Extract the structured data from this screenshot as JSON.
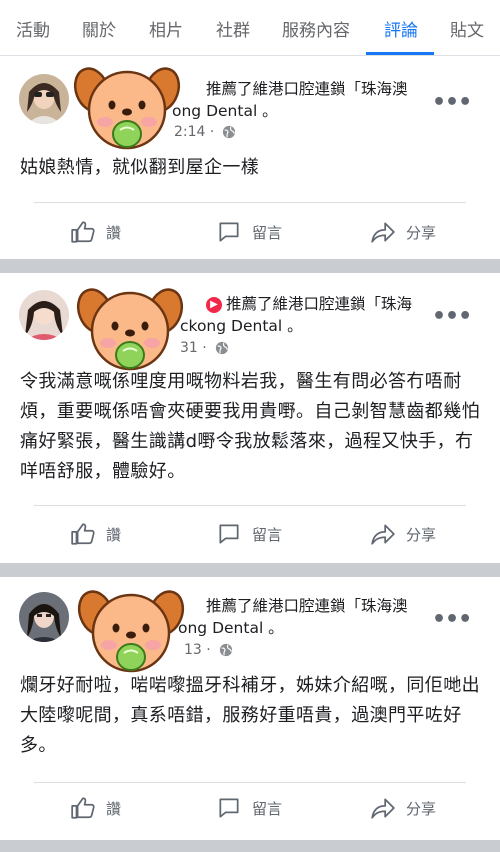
{
  "tabs": [
    {
      "label": "活動"
    },
    {
      "label": "關於"
    },
    {
      "label": "相片"
    },
    {
      "label": "社群"
    },
    {
      "label": "服務內容"
    },
    {
      "label": "評論"
    },
    {
      "label": "貼文"
    }
  ],
  "active_tab": "評論",
  "colors": {
    "accent": "#1877f2",
    "separator": "#c9ccd1",
    "text_secondary": "#65676b"
  },
  "posts": [
    {
      "header_line1": "推薦了維港口腔連鎖「珠海澳",
      "header_line2": "ong Dental 。",
      "time": "2:14 ·",
      "body": "姑娘熱情，就似翻到屋企一樣"
    },
    {
      "header_line1": "推薦了維港口腔連鎖「珠海",
      "header_line2": "ckong Dental 。",
      "time": "31 ·",
      "body": "令我滿意嘅係哩度用嘅物料岩我，醫生有問必答冇唔耐煩，重要嘅係唔會夾硬要我用貴嘢。自己剝智慧齒都幾怕痛好緊張，醫生識講d嘢令我放鬆落來，過程又快手，冇咩唔舒服，體驗好。"
    },
    {
      "header_line1": "推薦了維港口腔連鎖「珠海澳",
      "header_line2": "ong Dental 。",
      "time": "13 ·",
      "body": "爛牙好耐啦，啱啱嚟搵牙科補牙，姊妹介紹嘅，同佢哋出大陸嚟呢間，真系唔錯，服務好重唔貴，過澳門平咗好多。"
    }
  ],
  "actions": {
    "like": "讚",
    "comment": "留言",
    "share": "分享"
  },
  "icons": {
    "more": "more-icon",
    "globe": "globe-icon",
    "like": "thumbs-up-icon",
    "comment": "comment-icon",
    "share": "share-icon",
    "sticker": "dog-sticker"
  }
}
